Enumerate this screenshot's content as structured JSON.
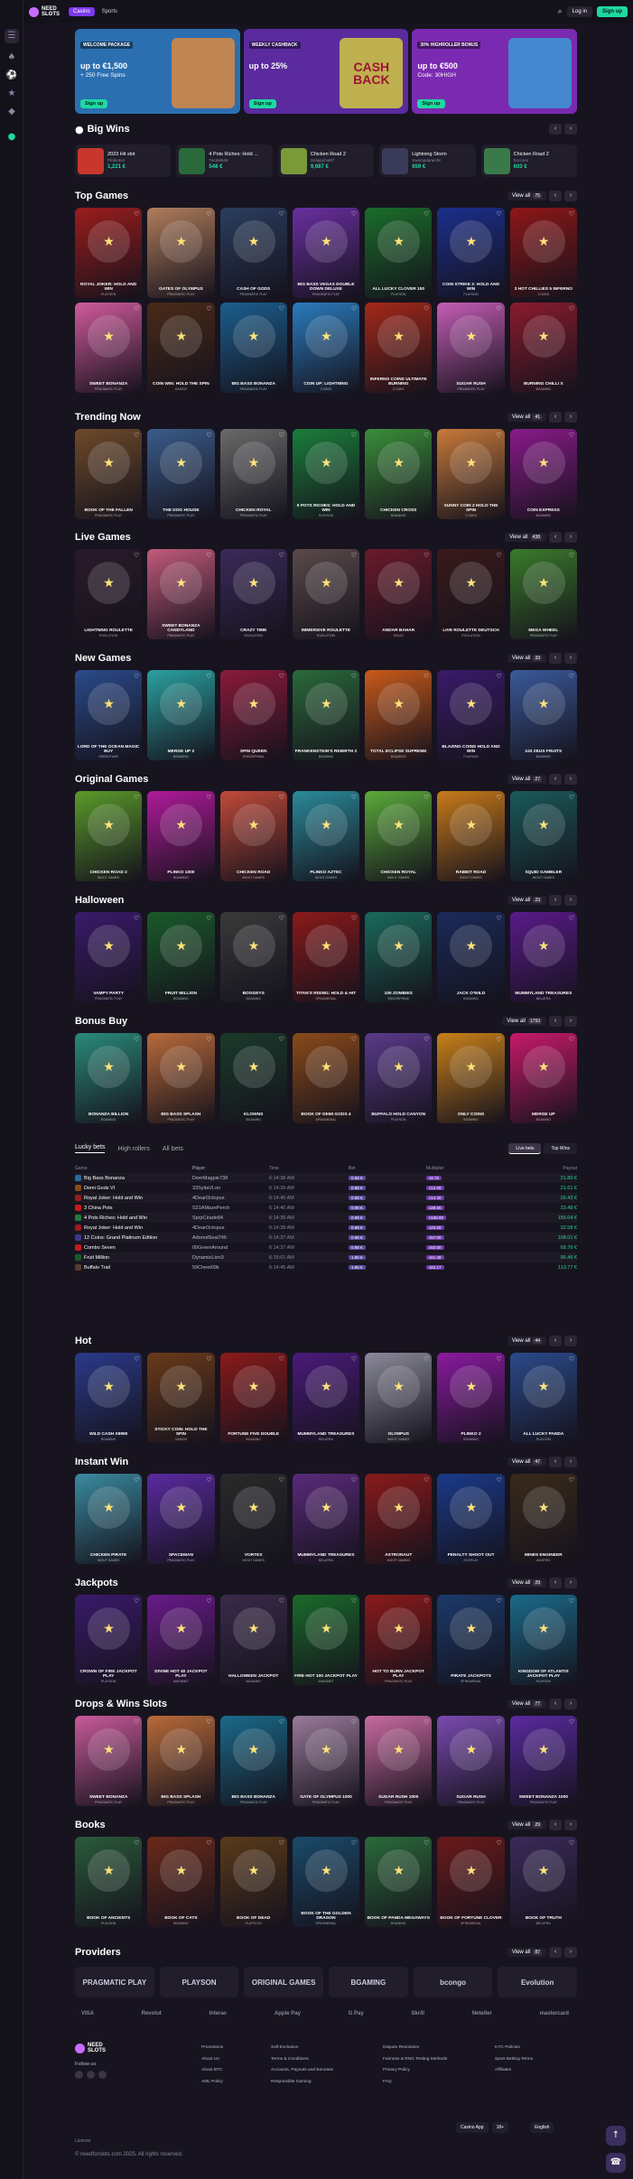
{
  "nav": {
    "casino": "Casino",
    "sports": "Sports",
    "login": "Log in",
    "signup": "Sign up"
  },
  "promos": [
    {
      "tag": "WELCOME PACKAGE",
      "title": "up to €1,500",
      "sub": "+ 250 Free Spins",
      "btn": "Sign up",
      "bg": "#2b6fb0",
      "art": "#e58b3c"
    },
    {
      "tag": "WEEKLY CASHBACK",
      "title": "up to 25%",
      "sub": "",
      "btn": "Sign up",
      "bg": "#5a2a9e",
      "art": "#d8d23b",
      "art_text": "CASH BACK"
    },
    {
      "tag": "30% HIGHROLLER BONUS",
      "title": "up to €500",
      "sub": "Code: 30HIGH",
      "btn": "Sign up",
      "bg": "#7a2ab0",
      "art": "#3aa0d8"
    }
  ],
  "bigwins": {
    "title": "Big Wins",
    "items": [
      {
        "game": "2023 Hit slot",
        "user": "Pirate4x4",
        "amount": "1,221 €",
        "color": "#c8372d"
      },
      {
        "game": "4 Pots Riches: Hold ...",
        "user": "Tomb6646",
        "amount": "548 €",
        "color": "#2a6a3a"
      },
      {
        "game": "Chicken Road 2",
        "user": "Snappyhat67",
        "amount": "9,687 €",
        "color": "#7a9a3a"
      },
      {
        "game": "Lightning Storm",
        "user": "Swampdaner48",
        "amount": "659 €",
        "color": "#3a3a5a"
      },
      {
        "game": "Chicken Road 2",
        "user": "Excrono",
        "amount": "603 €",
        "color": "#3a7a4a"
      }
    ]
  },
  "sections": [
    {
      "title": "Top Games",
      "count": "75",
      "rows": [
        [
          [
            "ROYAL JOKER: HOLD AND WIN",
            "PLAYSON",
            "#9b1c1c"
          ],
          [
            "GATES OF OLYMPUS",
            "PRAGMATIC PLAY",
            "#b07d5c"
          ],
          [
            "CASH OF GODS",
            "PRAGMATIC PLAY",
            "#2a3d5e"
          ],
          [
            "BIG BASS VEGAS DOUBLE DOWN DELUXE",
            "PRAGMATIC PLAY",
            "#6a2fa0"
          ],
          [
            "ALL LUCKY CLOVER 100",
            "PLAYSON",
            "#1a6e2a"
          ],
          [
            "COIN STRIKE 2: HOLD AND WIN",
            "PLAYSON",
            "#1b2f8c"
          ],
          [
            "3 HOT CHILLIES 5 INFERNO",
            "3 OAKS",
            "#8e1717"
          ]
        ],
        [
          [
            "SWEET BONANZA",
            "PRAGMATIC PLAY",
            "#d05a9c"
          ],
          [
            "COIN WIN: HOLD THE SPIN",
            "GAMZIX",
            "#4a2a18"
          ],
          [
            "BIG BASS BONANZA",
            "PRAGMATIC PLAY",
            "#1a5e8e"
          ],
          [
            "COIN UP: LIGHTNING",
            "3 OAKS",
            "#2a7bbd"
          ],
          [
            "INFERNO COINS ULTIMATE BURNING",
            "3 OAKS",
            "#a3281a"
          ],
          [
            "SUGAR RUSH",
            "PRAGMATIC PLAY",
            "#c45db5"
          ],
          [
            "BURNING CHILLI X",
            "BGAMING",
            "#8a1b2e"
          ]
        ]
      ]
    },
    {
      "title": "Trending Now",
      "count": "41",
      "rows": [
        [
          [
            "BOOK OF THE FALLEN",
            "PRAGMATIC PLAY",
            "#6e4a2a"
          ],
          [
            "THE DOG HOUSE",
            "PRAGMATIC PLAY",
            "#3a5c8a"
          ],
          [
            "CHICKEN ROYAL",
            "PRAGMATIC PLAY",
            "#6a6a6a"
          ],
          [
            "5 POTS RICHES: HOLD AND WIN",
            "PLAYSON",
            "#1a7e3a"
          ],
          [
            "CHICKEN CROSS",
            "BGAMING",
            "#3a8e3a"
          ],
          [
            "SUNNY COIN 2 HOLD THE SPIN",
            "3 OAKS",
            "#c87a3a"
          ],
          [
            "COIN EXPRESS",
            "BGAMING",
            "#8a1a8a"
          ]
        ]
      ]
    },
    {
      "title": "Live Games",
      "count": "438",
      "rows": [
        [
          [
            "LIGHTNING ROULETTE",
            "EVOLUTION",
            "#2a1a2a"
          ],
          [
            "SWEET BONANZA CANDYLAND",
            "PRAGMATIC PLAY",
            "#c05a7a"
          ],
          [
            "CRAZY TIME",
            "EVOLUTION",
            "#3a2a5a"
          ],
          [
            "IMMERSIVE ROULETTE",
            "EVOLUTION",
            "#5a4a4a"
          ],
          [
            "ANDAR BAHAR",
            "EZUGI",
            "#6a1a2a"
          ],
          [
            "LIVE ROULETTE DEUTSCH",
            "EVOLUTION",
            "#3a1a1a"
          ],
          [
            "MEGA WHEEL",
            "PRAGMATIC PLAY",
            "#3a7a2a"
          ]
        ]
      ]
    },
    {
      "title": "New Games",
      "count": "33",
      "rows": [
        [
          [
            "LORD OF THE OCEAN MAGIC BUY",
            "GREENTUBE",
            "#2a4a8a"
          ],
          [
            "MERGE UP 2",
            "BGAMING",
            "#2aa0a0"
          ],
          [
            "SPIN QUEEN",
            "ENDORPHINA",
            "#8a1a3a"
          ],
          [
            "FRANKENSTEIN'S REBIRTH 2",
            "BGAMING",
            "#2a6a3a"
          ],
          [
            "TOTAL ECLIPSE SUPREME",
            "BGAMING",
            "#c85a1a"
          ],
          [
            "BLAZING COINS HOLD AND WIN",
            "PLAYSON",
            "#3a1a6a"
          ],
          [
            "243 ZEUS FRUITS",
            "BGAMING",
            "#3a5a9a"
          ]
        ]
      ]
    },
    {
      "title": "Original Games",
      "count": "27",
      "rows": [
        [
          [
            "CHICKEN ROAD 2",
            "INOUT GAMES",
            "#5a9a2a"
          ],
          [
            "PLINKO 1000",
            "BGAMING",
            "#b01a9a"
          ],
          [
            "CHICKEN ROAD",
            "INOUT GAMES",
            "#c04a3a"
          ],
          [
            "PLINKO AZTEC",
            "INOUT GAMES",
            "#2a8a9a"
          ],
          [
            "CHICKEN ROYAL",
            "INOUT GAMES",
            "#5aaa3a"
          ],
          [
            "RABBIT ROAD",
            "INOUT GAMES",
            "#c87a1a"
          ],
          [
            "SQUID GAMBLER",
            "INOUT GAMES",
            "#1a5a5a"
          ]
        ]
      ]
    },
    {
      "title": "Halloween",
      "count": "23",
      "rows": [
        [
          [
            "VAMPY PARTY",
            "PRAGMATIC PLAY",
            "#3a1a6a"
          ],
          [
            "FRUIT MILLION",
            "BGAMING",
            "#1a5a2a"
          ],
          [
            "BOOGEYS",
            "BGAMING",
            "#3a3a3a"
          ],
          [
            "TITAN'S RISING: HOLD & HIT",
            "SPINOMENAL",
            "#8a1a1a"
          ],
          [
            "100 ZOMBIES",
            "ENDORPHINA",
            "#1a6a5a"
          ],
          [
            "JACK O'WILD",
            "BGAMING",
            "#1a2a5a"
          ],
          [
            "MUMMYLAND TREASURES",
            "BELATRA",
            "#5a1a8a"
          ]
        ]
      ]
    },
    {
      "title": "Bonus Buy",
      "count": "1793",
      "rows": [
        [
          [
            "BONANZA BILLION",
            "BGAMING",
            "#2a8a7a"
          ],
          [
            "BIG BASS SPLASH",
            "PRAGMATIC PLAY",
            "#b86a3a"
          ],
          [
            "KLOWNS",
            "BGAMING",
            "#1a3a2a"
          ],
          [
            "BOOK OF DEMI GODS 4",
            "SPINOMENAL",
            "#8a4a1a"
          ],
          [
            "BUFFALO HOLD CANYON",
            "PLAYSON",
            "#5a3a8a"
          ],
          [
            "ONLY COINS",
            "BGAMING",
            "#c8801a"
          ],
          [
            "MERGE UP",
            "BGAMING",
            "#c81a6a"
          ]
        ]
      ]
    }
  ],
  "bets": {
    "tabs": [
      "Lucky bets",
      "High rollers",
      "All bets"
    ],
    "toggle": [
      "Live bets",
      "Top Wins"
    ],
    "headers": [
      "Game",
      "Player",
      "Time",
      "Bet",
      "Multiplier",
      "Payout"
    ],
    "rows": [
      [
        "Big Bass Bonanza",
        "DeerMagpie738",
        "6:14:38 AM",
        "0.98 €",
        "x8.76",
        "21.80 €",
        "#2a6a9a"
      ],
      [
        "Demi Gods VI",
        "33SyltaVLon",
        "6:14:39 AM",
        "0.98 €",
        "x12.00",
        "21.61 €",
        "#8a4a1a"
      ],
      [
        "Royal Joker: Hold and Win",
        "4DearOctopus",
        "6:14:40 AM",
        "0.98 €",
        "x14.30",
        "26.43 €",
        "#9b1c1c"
      ],
      [
        "3 China Pots",
        "S21AMazePerch",
        "6:14:40 AM",
        "0.98 €",
        "x28.56",
        "33.48 €",
        "#c81a1a"
      ],
      [
        "4 Pots Riches: Hold and Win",
        "SprjrCirade84",
        "6:14:39 AM",
        "0.99 €",
        "x158.00",
        "156.04 €",
        "#1a7e3a"
      ],
      [
        "Royal Joker: Hold and Win",
        "4DearOctopus",
        "6:14:38 AM",
        "0.98 €",
        "x23.00",
        "32.58 €",
        "#9b1c1c"
      ],
      [
        "12 Coins: Grand Platinum Edition",
        "AdoredSeal746",
        "6:14:37 AM",
        "0.98 €",
        "x57.00",
        "108.01 €",
        "#3a3a8a"
      ],
      [
        "Combo Seven",
        "00GreenAround",
        "6:14:37 AM",
        "0.98 €",
        "x62.00",
        "68.76 €",
        "#c81a1a"
      ],
      [
        "Fruit Million",
        "DynamicLion3",
        "6:15:01 AM",
        "1.96 €",
        "x61.48",
        "96.46 €",
        "#1a5a2a"
      ],
      [
        "Buffalo Trail",
        "59Cheet09k",
        "6:14:45 AM",
        "1.96 €",
        "x62.17",
        "113.77 €",
        "#5a3a2a"
      ]
    ]
  },
  "sections2": [
    {
      "title": "Hot",
      "count": "44",
      "rows": [
        [
          [
            "WILD CASH X9990",
            "BGAMING",
            "#2a3a8a"
          ],
          [
            "STICKY COIN: HOLD THE SPIN",
            "GAMZIX",
            "#6a3a1a"
          ],
          [
            "FORTUNE FIVE DOUBLE",
            "BGAMING",
            "#8a1a1a"
          ],
          [
            "MUMMYLAND TREASURES",
            "BELATRA",
            "#4a1a7a"
          ],
          [
            "OLYMPUS",
            "INOUT GAMES",
            "#8a8a9a"
          ],
          [
            "PLINKO 2",
            "BGAMING",
            "#8a1aa0"
          ],
          [
            "ALL LUCKY PANDA",
            "PLAYSON",
            "#2a4a8a"
          ]
        ]
      ]
    },
    {
      "title": "Instant Win",
      "count": "47",
      "rows": [
        [
          [
            "CHICKEN PIRATE",
            "INOUT GAMES",
            "#3a8aa0"
          ],
          [
            "SPACEMAN",
            "PRAGMATIC PLAY",
            "#5a2aa0"
          ],
          [
            "VORTEX",
            "INOUT GAMES",
            "#2a2a2a"
          ],
          [
            "MUMMYLAND TREASURES",
            "BELATRA",
            "#5a2a7a"
          ],
          [
            "ASTRONAUT",
            "100HP GAMING",
            "#8a1a1a"
          ],
          [
            "PENALTY SHOOT OUT",
            "EVOPLAY",
            "#1a3a8a"
          ],
          [
            "MINES ENGINEER",
            "AVIATRIX",
            "#3a2a1a"
          ]
        ]
      ]
    },
    {
      "title": "Jackpots",
      "count": "29",
      "rows": [
        [
          [
            "CROWN OF FIRE JACKPOT PLAY",
            "PLAYSON",
            "#3a1a6a"
          ],
          [
            "DIVINE HOT 40 JACKPOT PLAY",
            "AMUSNET",
            "#6a1a8a"
          ],
          [
            "HALLOWEEN JACKPOT",
            "BGAMING",
            "#3a2a4a"
          ],
          [
            "FIRE HOT 100 JACKPOT PLAY",
            "AMUSNET",
            "#1a6a2a"
          ],
          [
            "HOT TO BURN JACKPOT PLAY",
            "PRAGMATIC PLAY",
            "#8a1a1a"
          ],
          [
            "PIRATE JACKPOTS",
            "SPINOMENAL",
            "#1a3a6a"
          ],
          [
            "KINGDOM OF ATLANTIS JACKPOT PLAY",
            "PLAYSON",
            "#1a6a8a"
          ]
        ]
      ]
    },
    {
      "title": "Drops & Wins Slots",
      "count": "77",
      "rows": [
        [
          [
            "SWEET BONANZA",
            "PRAGMATIC PLAY",
            "#c85a9a"
          ],
          [
            "BIG BASS SPLASH",
            "PRAGMATIC PLAY",
            "#b86a3a"
          ],
          [
            "BIG BASS BONANZA",
            "PRAGMATIC PLAY",
            "#1a6a8a"
          ],
          [
            "GATE OF OLYMPUS 1000",
            "PRAGMATIC PLAY",
            "#9a7a9a"
          ],
          [
            "SUGAR RUSH 1000",
            "PRAGMATIC PLAY",
            "#c86aa0"
          ],
          [
            "SUGAR RUSH",
            "PRAGMATIC PLAY",
            "#7a4ab0"
          ],
          [
            "SWEET BONANZA 1000",
            "PRAGMATIC PLAY",
            "#5a2aa0"
          ]
        ]
      ]
    },
    {
      "title": "Books",
      "count": "29",
      "rows": [
        [
          [
            "BOOK OF ANCIENTS",
            "PLAYSON",
            "#2a5a3a"
          ],
          [
            "BOOK OF CATS",
            "BGAMING",
            "#6a2a1a"
          ],
          [
            "BOOK OF DEAD",
            "PLAY'N GO",
            "#5a3a1a"
          ],
          [
            "BOOK OF THE GOLDEN DRAGON",
            "SPINOMENAL",
            "#1a4a6a"
          ],
          [
            "BOOK OF PANDA MEGAWAYS",
            "BGAMING",
            "#2a6a3a"
          ],
          [
            "BOOK OF FORTUNE CLOVER",
            "SPINOMENAL",
            "#6a1a1a"
          ],
          [
            "BOOK OF TRUTH",
            "BELATRA",
            "#3a2a5a"
          ]
        ]
      ]
    }
  ],
  "providers": {
    "title": "Providers",
    "count": "87",
    "items": [
      "PRAGMATIC PLAY",
      "PLAYSON",
      "ORIGINAL GAMES",
      "BGAMING",
      "bcongo",
      "Evolution"
    ]
  },
  "payments": [
    "VISA",
    "Revolut",
    "Interac",
    "Apple Pay",
    "G Pay",
    "Skrill",
    "Neteller",
    "mastercard"
  ],
  "footer": {
    "follow": "Follow us",
    "col1": [
      "Promotions",
      "About Us",
      "About BTC",
      "AML Policy"
    ],
    "col2": [
      "Self-Exclusion",
      "Terms & Conditions",
      "Accounts, Payouts and Bonuses",
      "Responsible Gaming"
    ],
    "col3": [
      "Dispute Resolution",
      "Fairness & RNG Testing Methods",
      "Privacy Policy",
      "FAQ"
    ],
    "col4": [
      "KYC Policies",
      "Sport Betting Terms",
      "Affiliates"
    ],
    "license": "License",
    "copyright": "© needforslots.com 2025. All rights reserved.",
    "app": "Casino App",
    "lang": "English",
    "age": "18+"
  },
  "view_all": "View all"
}
